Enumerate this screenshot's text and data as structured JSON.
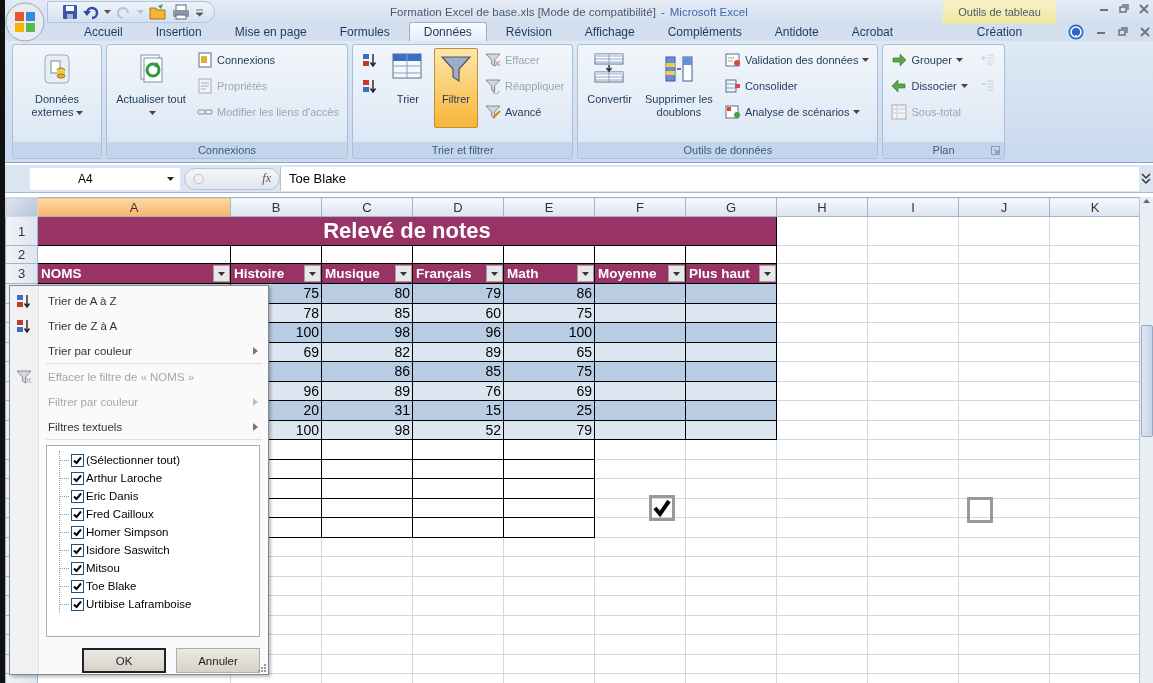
{
  "title_bar": {
    "document": "Formation Excel de base.xls  [Mode de compatibilité]",
    "separator": "-",
    "application": "Microsoft Excel",
    "contextual_group": "Outils de tableau"
  },
  "tabs": [
    {
      "label": "Accueil",
      "selected": false,
      "kind": "standard"
    },
    {
      "label": "Insertion",
      "selected": false,
      "kind": "standard"
    },
    {
      "label": "Mise en page",
      "selected": false,
      "kind": "standard"
    },
    {
      "label": "Formules",
      "selected": false,
      "kind": "standard"
    },
    {
      "label": "Données",
      "selected": true,
      "kind": "standard"
    },
    {
      "label": "Révision",
      "selected": false,
      "kind": "standard"
    },
    {
      "label": "Affichage",
      "selected": false,
      "kind": "standard"
    },
    {
      "label": "Compléments",
      "selected": false,
      "kind": "standard"
    },
    {
      "label": "Antidote",
      "selected": false,
      "kind": "standard"
    },
    {
      "label": "Acrobat",
      "selected": false,
      "kind": "standard"
    },
    {
      "label": "Création",
      "selected": false,
      "kind": "contextual"
    }
  ],
  "ribbon": {
    "groups": [
      {
        "launcher": false,
        "controls": [
          {
            "kind": "large",
            "label": "Données externes",
            "menu": true,
            "disabled": false,
            "active": false
          }
        ]
      },
      {
        "label": "Connexions",
        "launcher": false,
        "controls": [
          {
            "kind": "large",
            "label": "Actualiser tout",
            "menu": true,
            "disabled": false,
            "active": false
          },
          {
            "kind": "small",
            "label": "Connexions",
            "menu": false,
            "disabled": false,
            "active": false
          },
          {
            "kind": "small",
            "label": "Propriétés",
            "menu": false,
            "disabled": true,
            "active": false
          },
          {
            "kind": "small",
            "label": "Modifier les liens d'accès",
            "menu": false,
            "disabled": true,
            "active": false
          }
        ]
      },
      {
        "label": "Trier et filtrer",
        "launcher": false,
        "controls": [
          {
            "kind": "icon",
            "menu": false,
            "disabled": false,
            "active": false
          },
          {
            "kind": "icon",
            "menu": false,
            "disabled": false,
            "active": false
          },
          {
            "kind": "large",
            "label": "Trier",
            "menu": false,
            "disabled": false,
            "active": false
          },
          {
            "kind": "large",
            "label": "Filtrer",
            "menu": false,
            "disabled": false,
            "active": true
          },
          {
            "kind": "small",
            "label": "Effacer",
            "menu": false,
            "disabled": true,
            "active": false
          },
          {
            "kind": "small",
            "label": "Réappliquer",
            "menu": false,
            "disabled": true,
            "active": false
          },
          {
            "kind": "small",
            "label": "Avancé",
            "menu": false,
            "disabled": false,
            "active": false
          }
        ]
      },
      {
        "label": "Outils de données",
        "launcher": false,
        "controls": [
          {
            "kind": "large",
            "label": "Convertir",
            "menu": false,
            "disabled": false,
            "active": false
          },
          {
            "kind": "large",
            "label": "Supprimer les doublons",
            "menu": false,
            "disabled": false,
            "active": false
          },
          {
            "kind": "small",
            "label": "Validation des données",
            "menu": true,
            "disabled": false,
            "active": false
          },
          {
            "kind": "small",
            "label": "Consolider",
            "menu": false,
            "disabled": false,
            "active": false
          },
          {
            "kind": "small",
            "label": "Analyse de scénarios",
            "menu": true,
            "disabled": false,
            "active": false
          }
        ]
      },
      {
        "label": "Plan",
        "launcher": true,
        "controls": [
          {
            "kind": "small",
            "label": "Grouper",
            "menu": true,
            "disabled": false,
            "active": false
          },
          {
            "kind": "small",
            "label": "Dissocier",
            "menu": true,
            "disabled": false,
            "active": false
          },
          {
            "kind": "small",
            "label": "Sous-total",
            "menu": false,
            "disabled": true,
            "active": false
          },
          {
            "kind": "icon",
            "menu": false,
            "disabled": true,
            "active": false
          },
          {
            "kind": "icon",
            "menu": false,
            "disabled": true,
            "active": false
          }
        ]
      }
    ]
  },
  "formula_bar": {
    "name_box": "A4",
    "function_button": "fx",
    "formula": "Toe Blake"
  },
  "sheet": {
    "columns": [
      {
        "label": "A",
        "selected": true
      },
      {
        "label": "B",
        "selected": false
      },
      {
        "label": "C",
        "selected": false
      },
      {
        "label": "D",
        "selected": false
      },
      {
        "label": "E",
        "selected": false
      },
      {
        "label": "F",
        "selected": false
      },
      {
        "label": "G",
        "selected": false
      },
      {
        "label": "H",
        "selected": false
      },
      {
        "label": "I",
        "selected": false
      },
      {
        "label": "J",
        "selected": false
      },
      {
        "label": "K",
        "selected": false
      }
    ],
    "row_numbers": [
      "1",
      "2",
      "3"
    ],
    "title": "Relevé de notes",
    "headers": [
      "NOMS",
      "Histoire",
      "Musique",
      "Français",
      "Math",
      "Moyenne",
      "Plus haut"
    ],
    "rows": [
      [
        "",
        "75",
        "80",
        "79",
        "86",
        "",
        ""
      ],
      [
        "",
        "78",
        "85",
        "60",
        "75",
        "",
        ""
      ],
      [
        "",
        "100",
        "98",
        "96",
        "100",
        "",
        ""
      ],
      [
        "",
        "69",
        "82",
        "89",
        "65",
        "",
        ""
      ],
      [
        "",
        "",
        "86",
        "85",
        "75",
        "",
        ""
      ],
      [
        "",
        "96",
        "89",
        "76",
        "69",
        "",
        ""
      ],
      [
        "",
        "20",
        "31",
        "15",
        "25",
        "",
        ""
      ],
      [
        "",
        "100",
        "98",
        "52",
        "79",
        "",
        ""
      ]
    ]
  },
  "filter_menu": {
    "items": [
      {
        "kind": "sort-ascending",
        "label": "Trier de A à Z",
        "disabled": false,
        "submenu": false
      },
      {
        "kind": "sort-descending",
        "label": "Trier de Z à A",
        "disabled": false,
        "submenu": false
      },
      {
        "kind": "plain",
        "label": "Trier par couleur",
        "disabled": false,
        "submenu": true
      },
      {
        "kind": "separator"
      },
      {
        "kind": "clear-filter",
        "label": "Effacer le filtre de « NOMS »",
        "disabled": true,
        "submenu": false
      },
      {
        "kind": "plain",
        "label": "Filtrer par couleur",
        "disabled": true,
        "submenu": true
      },
      {
        "kind": "plain",
        "label": "Filtres textuels",
        "disabled": false,
        "submenu": true
      }
    ],
    "values": [
      {
        "label": "(Sélectionner tout)",
        "checked": true
      },
      {
        "label": "Arthur Laroche",
        "checked": true
      },
      {
        "label": "Eric Danis",
        "checked": true
      },
      {
        "label": "Fred Cailloux",
        "checked": true
      },
      {
        "label": "Homer Simpson",
        "checked": true
      },
      {
        "label": "Isidore Saswitch",
        "checked": true
      },
      {
        "label": "Mitsou",
        "checked": true
      },
      {
        "label": "Toe Blake",
        "checked": true
      },
      {
        "label": "Urtibise Laframboise",
        "checked": true
      }
    ],
    "buttons": [
      {
        "label": "OK",
        "default": true
      },
      {
        "label": "Annuler",
        "default": false
      }
    ]
  },
  "stray_checkboxes": [
    {
      "checked": true
    },
    {
      "checked": false
    }
  ]
}
